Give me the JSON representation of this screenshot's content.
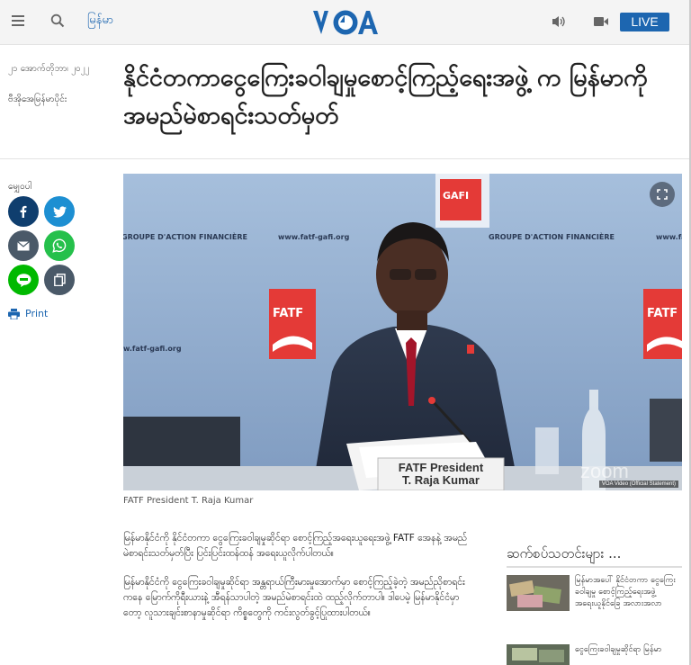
{
  "header": {
    "language_label": "မြန်မာ",
    "live_label": "LIVE",
    "logo_text": "VOA",
    "brand_color": "#1d66b0"
  },
  "article": {
    "date": "၂၁ အောက်တိုဘာ၊ ၂၀၂၂",
    "author": "ဗီအိုအေမြန်မာပိုင်း",
    "headline": "နိုင်ငံတကာငွေကြေးခဝါချမှုစောင့်ကြည့်ရေးအဖွဲ့ က မြန်မာကိုအမည်မဲစာရင်းသတ်မှတ်",
    "caption": "FATF President T. Raja Kumar",
    "paragraphs": [
      "မြန်မာနိုင်ငံကို နိုင်ငံတကာ ငွေကြေးခဝါချမှုဆိုင်ရာ စောင့်ကြည့်အရေးယူရေးအဖွဲ့ FATF အေနနဲ့ အမည်မဲစာရင်းသတ်မှတ်ပြီး ပြင်းပြင်းထန်ထန် အရေးယူလိုက်ပါတယ်။",
      "မြန်မာနိုင်ငံကို ငွေကြေးခဝါချမှုဆိုင်ရာ အန္တရာယ်ကြီးမားမှုအောက်မှာ စောင့်ကြည့်ခဲ့တဲ့ အမည်ညိုစာရင်းကနေ မြောက်ကိုရီးယားနဲ့ အီရန်သာပါတဲ့ အမည်မဲစာရင်းထဲ ထည့်လိုက်တာပါ။ ဒါပေမဲ့ မြန်မာနိုင်ငံမှာတော့ လူသားချင်းစာနာမှုဆိုင်ရာ ကိစ္စတွေကို ကင်းလွတ်ခွင့်ပြုထားပါတယ်။"
    ]
  },
  "share": {
    "label": "မျှေဝပါ",
    "print_label": "Print",
    "colors": {
      "facebook": "#0f3e6e",
      "twitter": "#1d8fd2",
      "email": "#4a5968",
      "whatsapp": "#25c04b",
      "line": "#00b900",
      "copy": "#4a5968"
    }
  },
  "hero": {
    "banner_left": "GROUPE D'ACTION FINANCIÈRE",
    "banner_right": "GROUPE D'ACTION FINANCIÈRE",
    "url_left": "www.fatf-gafi.org",
    "url_right": "www.fatf",
    "url_bottom": "w.fatf-gafi.org",
    "gafi_label": "GAFI",
    "fatf_label": "FATF",
    "nameplate_line1": "FATF President",
    "nameplate_line2": "T. Raja Kumar",
    "watermark": "zoom",
    "credit": "VOA Video (Official Statement)"
  },
  "related": {
    "title": "ဆက်စပ်သတင်းများ ...",
    "items": [
      {
        "text": "မြန်မာအပေါ် နိုင်ငံတကာ ငွေကြေးခဝါချမှု စောင့်ကြည့်ရေးအဖွဲ့ အရေးယူနိုင်ခြေ အလားအလာ"
      },
      {
        "text": "ငွေကြေးခဝါချမှုဆိုင်ရာ မြန်မာ"
      }
    ]
  }
}
